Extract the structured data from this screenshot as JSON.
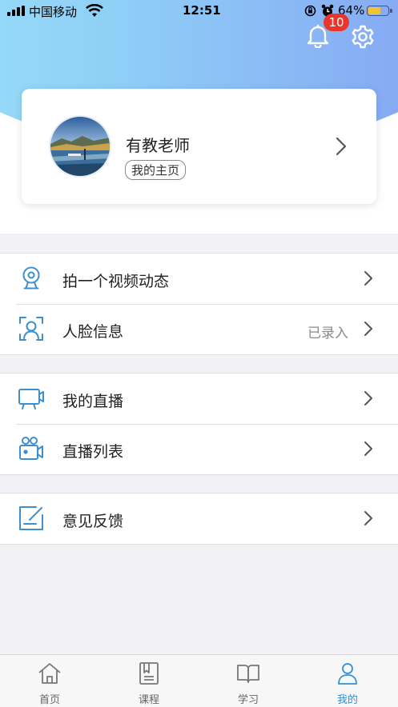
{
  "status_bar": {
    "carrier": "中国移动",
    "time": "12:51",
    "battery_percent": "64%",
    "battery_level": 0.64
  },
  "header": {
    "notification_count": "10"
  },
  "profile": {
    "name": "有教老师",
    "homepage_label": "我的主页"
  },
  "menu_groups": [
    [
      {
        "label": "拍一个视频动态",
        "value": "",
        "icon": "webcam-icon"
      },
      {
        "label": "人脸信息",
        "value": "已录入",
        "icon": "face-scan-icon"
      }
    ],
    [
      {
        "label": "我的直播",
        "value": "",
        "icon": "live-monitor-icon"
      },
      {
        "label": "直播列表",
        "value": "",
        "icon": "video-camera-icon"
      }
    ],
    [
      {
        "label": "意见反馈",
        "value": "",
        "icon": "feedback-edit-icon"
      }
    ]
  ],
  "tabbar": {
    "tabs": [
      {
        "label": "首页",
        "icon": "home-icon"
      },
      {
        "label": "课程",
        "icon": "course-book-icon"
      },
      {
        "label": "学习",
        "icon": "open-book-icon"
      },
      {
        "label": "我的",
        "icon": "user-icon"
      }
    ],
    "active_index": 3
  },
  "colors": {
    "accent": "#2f8fd8",
    "icon_blue": "#3d8fce",
    "badge": "#e8362c",
    "battery": "#f2c230"
  }
}
